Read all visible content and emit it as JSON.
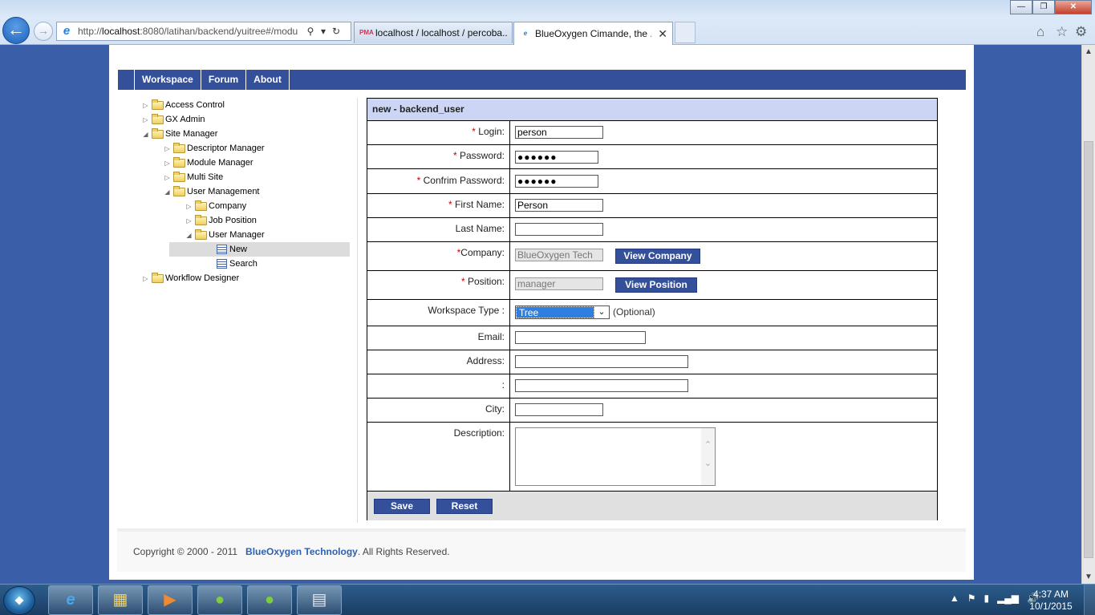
{
  "browser": {
    "url_prefix": "http://",
    "url_host": "localhost",
    "url_rest": ":8080/latihan/backend/yuitree#/modu",
    "tabs": [
      {
        "title": "localhost / localhost / percoba...",
        "favicon": "pma-icon"
      },
      {
        "title": "BlueOxygen Cimande, the ...",
        "favicon": "ie-page-icon"
      }
    ],
    "tab_close": "✕"
  },
  "nav": {
    "items": [
      "Workspace",
      "Forum",
      "About"
    ]
  },
  "tree": {
    "items": [
      {
        "label": "Access Control",
        "level": 0,
        "expanded": false,
        "type": "folder"
      },
      {
        "label": "GX Admin",
        "level": 0,
        "expanded": false,
        "type": "folder"
      },
      {
        "label": "Site Manager",
        "level": 0,
        "expanded": true,
        "type": "folder"
      },
      {
        "label": "Descriptor Manager",
        "level": 1,
        "expanded": false,
        "type": "folder"
      },
      {
        "label": "Module Manager",
        "level": 1,
        "expanded": false,
        "type": "folder"
      },
      {
        "label": "Multi Site",
        "level": 1,
        "expanded": false,
        "type": "folder"
      },
      {
        "label": "User Management",
        "level": 1,
        "expanded": true,
        "type": "folder"
      },
      {
        "label": "Company",
        "level": 2,
        "expanded": false,
        "type": "folder"
      },
      {
        "label": "Job Position",
        "level": 2,
        "expanded": false,
        "type": "folder"
      },
      {
        "label": "User Manager",
        "level": 2,
        "expanded": true,
        "type": "folder"
      },
      {
        "label": "New",
        "level": 3,
        "type": "page",
        "selected": true
      },
      {
        "label": "Search",
        "level": 3,
        "type": "page"
      },
      {
        "label": "Workflow Designer",
        "level": 0,
        "expanded": false,
        "type": "folder"
      }
    ]
  },
  "form": {
    "title": "new - backend_user",
    "required_mark": "*",
    "login": {
      "label": "Login:",
      "value": "person"
    },
    "password": {
      "label": "Password:",
      "value": "●●●●●●"
    },
    "confirm_password": {
      "label": "Confrim Password:",
      "value": "●●●●●●"
    },
    "first_name": {
      "label": "First Name:",
      "value": "Person"
    },
    "last_name": {
      "label": "Last Name:",
      "value": ""
    },
    "company": {
      "label": "Company:",
      "value": "BlueOxygen Tech",
      "button": "View Company"
    },
    "position": {
      "label": "Position:",
      "value": "manager",
      "button": "View Position"
    },
    "workspace_type": {
      "label": "Workspace Type :",
      "value": "Tree",
      "hint": "(Optional)"
    },
    "email": {
      "label": "Email:",
      "value": ""
    },
    "address": {
      "label": "Address:",
      "value": ""
    },
    "address2": {
      "label": ":",
      "value": ""
    },
    "city": {
      "label": "City:",
      "value": ""
    },
    "description": {
      "label": "Description:",
      "value": ""
    },
    "save_label": "Save",
    "reset_label": "Reset"
  },
  "footer": {
    "copyright": "Copyright © 2000 - 2011",
    "company_link": "BlueOxygen Technology",
    "rights": ". All Rights Reserved."
  },
  "taskbar": {
    "clock_time": "4:37 AM",
    "clock_date": "10/1/2015"
  },
  "colors": {
    "nav_bg": "#34509b",
    "form_title_bg": "#ccd6f4",
    "link": "#2f5fb0",
    "required": "#cc0000"
  }
}
